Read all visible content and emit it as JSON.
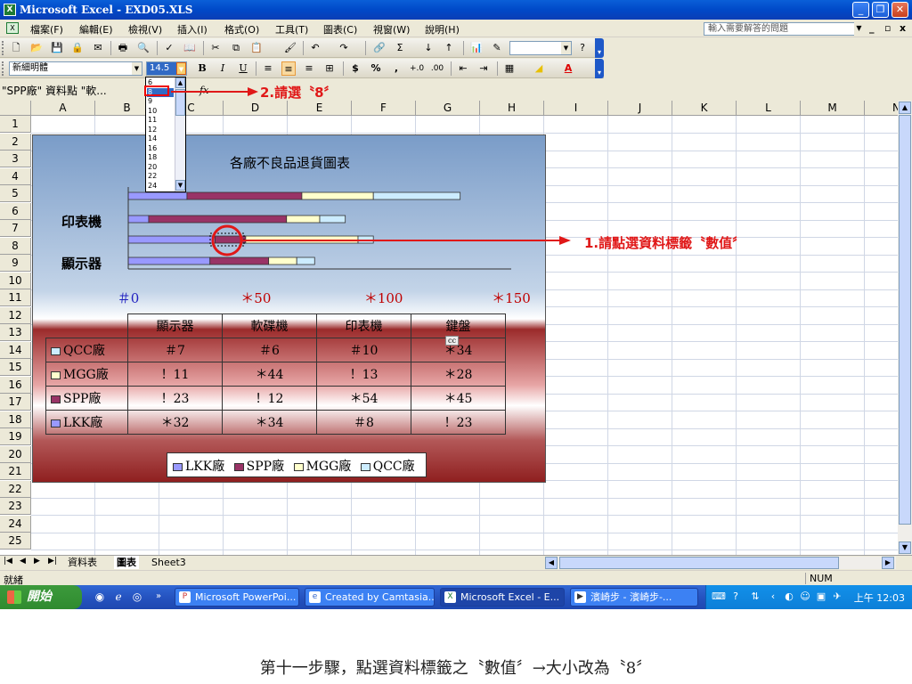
{
  "window": {
    "title": "Microsoft Excel - EXD05.XLS",
    "controls": [
      "_",
      "❐",
      "✕"
    ]
  },
  "menu": {
    "items": [
      "檔案(F)",
      "編輯(E)",
      "檢視(V)",
      "插入(I)",
      "格式(O)",
      "工具(T)",
      "圖表(C)",
      "視窗(W)",
      "說明(H)"
    ],
    "help_placeholder": "輸入需要解答的問題",
    "win_controls": [
      "_",
      "▫",
      "x"
    ]
  },
  "toolbar": {
    "font_name": "新細明體",
    "font_size": "14.5",
    "bold": "B",
    "italic": "I",
    "underline": "U",
    "currency": "$",
    "percent": "%",
    "comma": ","
  },
  "formula": {
    "name_box": "\"SPP廠\" 資料點 \"軟...",
    "fx": "fx"
  },
  "font_size_options": [
    "6",
    "8",
    "9",
    "10",
    "11",
    "12",
    "14",
    "16",
    "18",
    "20",
    "22",
    "24"
  ],
  "font_size_selected": "8",
  "columns": [
    "A",
    "B",
    "C",
    "D",
    "E",
    "F",
    "G",
    "H",
    "I",
    "J",
    "K",
    "L",
    "M",
    "N"
  ],
  "rows": [
    "1",
    "2",
    "3",
    "4",
    "5",
    "6",
    "7",
    "8",
    "9",
    "10",
    "11",
    "12",
    "13",
    "14",
    "15",
    "16",
    "17",
    "18",
    "19",
    "20",
    "21",
    "22",
    "23",
    "24",
    "25"
  ],
  "chart": {
    "title": "各廠不良品退貨圖表",
    "category_labels": [
      "印表機",
      "顯示器"
    ],
    "axis_ticks": [
      "＃0",
      "＊50",
      "＊100",
      "＊150"
    ],
    "table_headers": [
      "顯示器",
      "軟碟機",
      "印表機",
      "鍵盤"
    ],
    "table_rows": [
      {
        "name": "QCC廠",
        "values": [
          "＃7",
          "＃6",
          "＃10",
          "＊34"
        ],
        "color": "#ccecff"
      },
      {
        "name": "MGG廠",
        "values": [
          "！11",
          "＊44",
          "！13",
          "＊28"
        ],
        "color": "#ffffcc"
      },
      {
        "name": "SPP廠",
        "values": [
          "！23",
          "！12",
          "＊54",
          "＊45"
        ],
        "color": "#993366"
      },
      {
        "name": "LKK廠",
        "values": [
          "＊32",
          "＊34",
          "＃8",
          "！23"
        ],
        "color": "#9999ff"
      }
    ],
    "legend": [
      "LKK廠",
      "SPP廠",
      "MGG廠",
      "QCC廠"
    ],
    "tooltip": "cc"
  },
  "chart_data": {
    "type": "bar",
    "orientation": "horizontal-stacked",
    "title": "各廠不良品退貨圖表",
    "categories": [
      "顯示器",
      "軟碟機",
      "印表機",
      "鍵盤"
    ],
    "series": [
      {
        "name": "LKK廠",
        "values": [
          32,
          34,
          8,
          23
        ],
        "color": "#9999ff"
      },
      {
        "name": "SPP廠",
        "values": [
          23,
          12,
          54,
          45
        ],
        "color": "#993366"
      },
      {
        "name": "MGG廠",
        "values": [
          11,
          44,
          13,
          28
        ],
        "color": "#ffffcc"
      },
      {
        "name": "QCC廠",
        "values": [
          7,
          6,
          10,
          34
        ],
        "color": "#ccecff"
      }
    ],
    "xlim": [
      0,
      150
    ],
    "legend_position": "bottom"
  },
  "annotations": {
    "step1": "1.請點選資料標籤〝數值〞",
    "step2": "2.請選〝8〞"
  },
  "sheets": [
    "資料表",
    "圖表",
    "Sheet3"
  ],
  "status": {
    "ready": "就緒",
    "num": "NUM"
  },
  "taskbar": {
    "start": "開始",
    "tasks": [
      "Microsoft PowerPoi...",
      "Created by Camtasia...",
      "Microsoft Excel - E...",
      "濱崎步 - 濱崎步-..."
    ],
    "clock": "上午 12:03"
  },
  "caption": "第十一步驟，點選資料標籤之〝數值〞→大小改為〝8〞"
}
